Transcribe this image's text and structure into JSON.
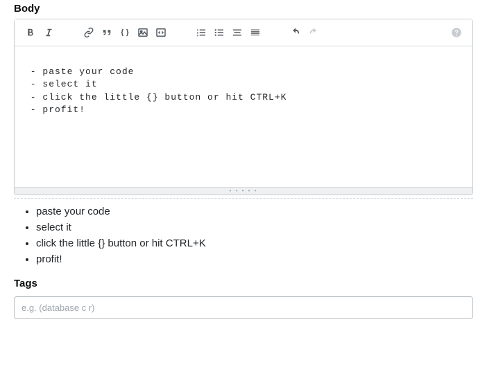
{
  "body_label": "Body",
  "editor_text": "\n - paste your code\n - select it\n - click the little {} button or hit CTRL+K\n - profit!\n",
  "preview_items": [
    "paste your code",
    "select it",
    "click the little {} button or hit CTRL+K",
    "profit!"
  ],
  "tags_label": "Tags",
  "tags_placeholder": "e.g. (database c r)"
}
